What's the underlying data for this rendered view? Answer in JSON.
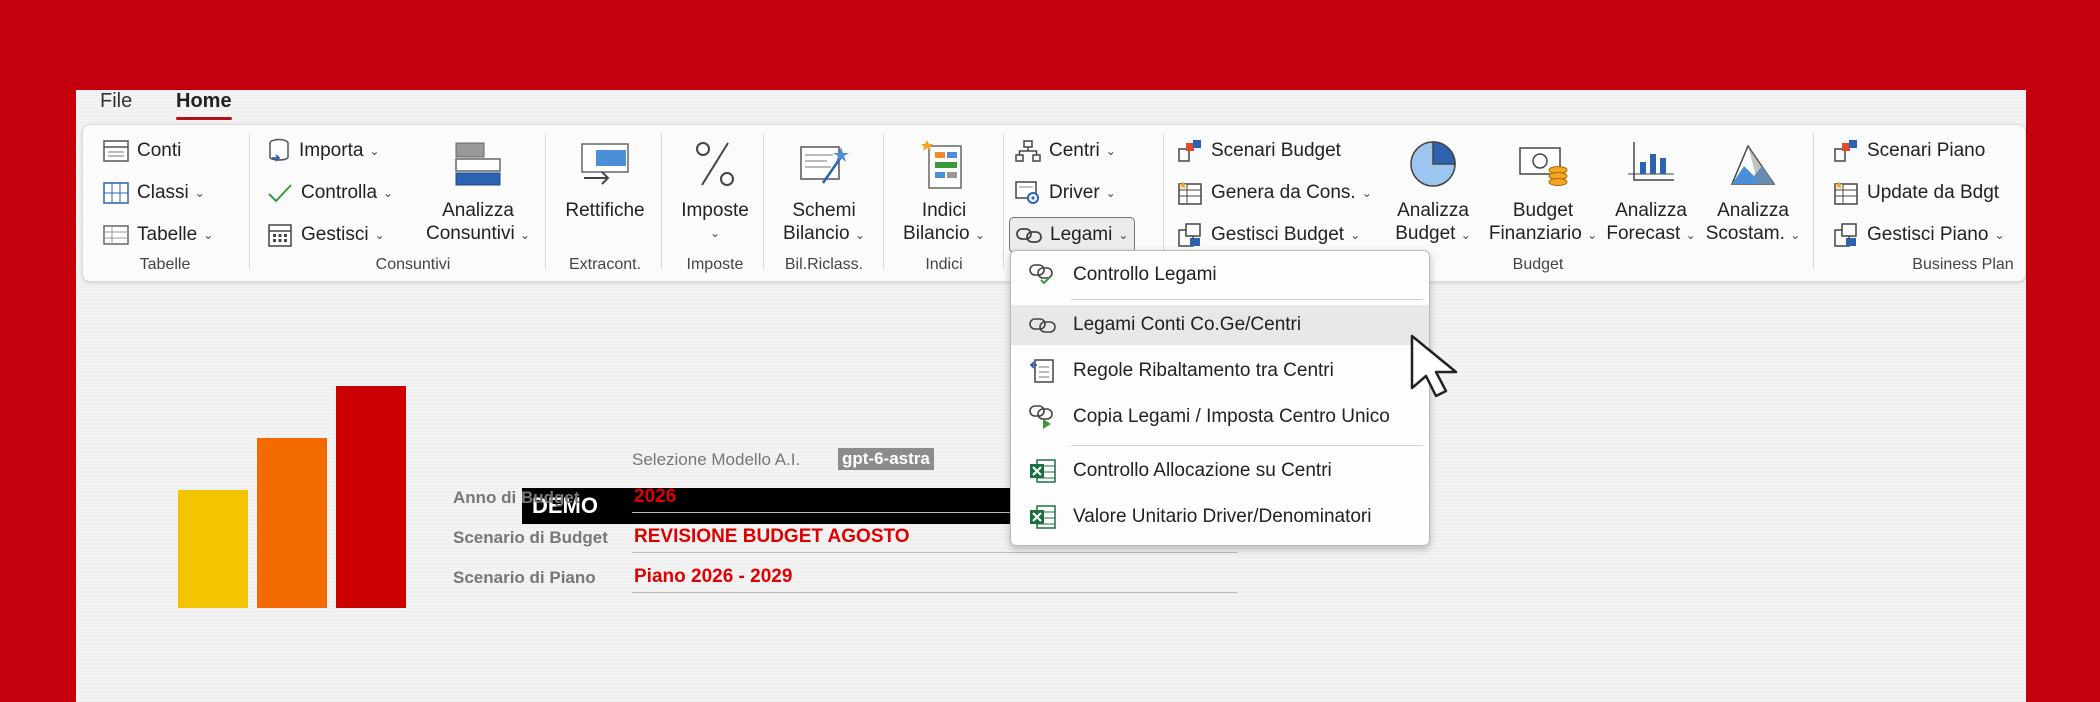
{
  "menu": {
    "file": "File",
    "home": "Home"
  },
  "ribbon": {
    "tabelle": {
      "conti": "Conti",
      "classi": "Classi",
      "tabelle": "Tabelle",
      "group": "Tabelle"
    },
    "consuntivi": {
      "importa": "Importa",
      "controlla": "Controlla",
      "gestisci": "Gestisci",
      "analizza_1": "Analizza",
      "analizza_2": "Consuntivi",
      "group": "Consuntivi"
    },
    "extracont": {
      "rettifiche": "Rettifiche",
      "group": "Extracont."
    },
    "imposte": {
      "imposte": "Imposte",
      "group": "Imposte"
    },
    "bilriclass": {
      "schemi_1": "Schemi",
      "schemi_2": "Bilancio",
      "group": "Bil.Riclass."
    },
    "indici": {
      "indici_1": "Indici",
      "indici_2": "Bilancio",
      "group": "Indici"
    },
    "centri": {
      "centri": "Centri",
      "driver": "Driver",
      "legami": "Legami"
    },
    "budget": {
      "scenari": "Scenari Budget",
      "genera": "Genera da Cons.",
      "gestisci": "Gestisci Budget",
      "analizza_1": "Analizza",
      "analizza_2": "Budget",
      "finanz_1": "Budget",
      "finanz_2": "Finanziario",
      "forecast_1": "Analizza",
      "forecast_2": "Forecast",
      "scostam_1": "Analizza",
      "scostam_2": "Scostam.",
      "group": "Budget"
    },
    "bp": {
      "scenari": "Scenari Piano",
      "update": "Update da Bdgt",
      "gestisci": "Gestisci Piano",
      "group": "Business Plan"
    }
  },
  "dropdown": {
    "items": [
      "Controllo Legami",
      "Legami Conti Co.Ge/Centri",
      "Regole Ribaltamento tra Centri",
      "Copia Legami / Imposta Centro Unico",
      "Controllo Allocazione su Centri",
      "Valore Unitario Driver/Denominatori"
    ]
  },
  "form": {
    "demo": "DEMO",
    "modello_label": "Selezione Modello A.I.",
    "modello_value": "gpt-6-astra",
    "anno_label": "Anno di Budget",
    "anno_value": "2026",
    "scenario_label": "Scenario di Budget",
    "scenario_value": "REVISIONE BUDGET AGOSTO",
    "piano_label": "Scenario di Piano",
    "piano_value": "Piano 2026 - 2029"
  },
  "colors": {
    "background": "#c4000f",
    "bar_yellow": "#f5c400",
    "bar_orange": "#f26a00",
    "bar_red": "#cc0000",
    "accent": "#b3101e",
    "value_red": "#e00000"
  }
}
